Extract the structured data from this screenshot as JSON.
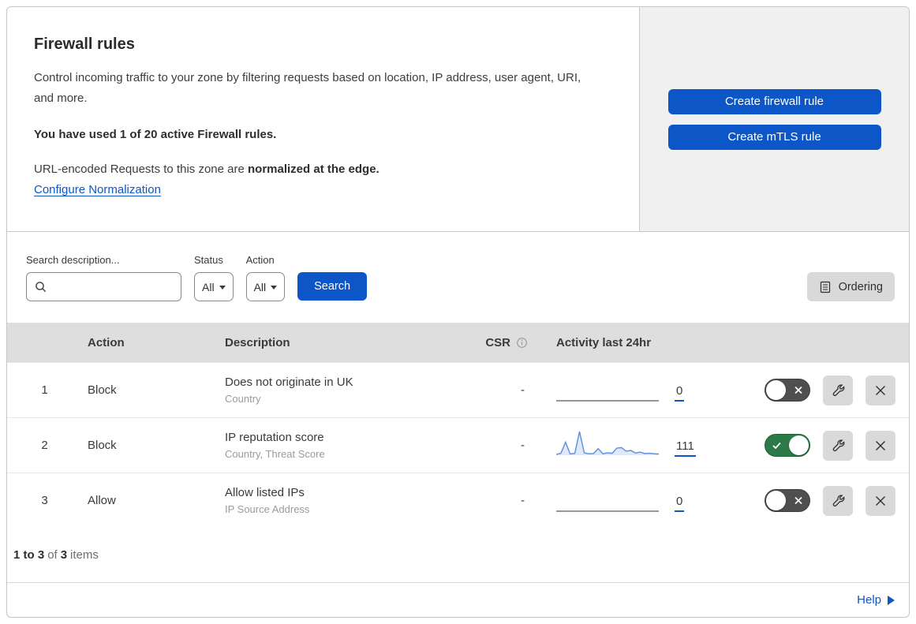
{
  "header": {
    "title": "Firewall rules",
    "description": "Control incoming traffic to your zone by filtering requests based on location, IP address, user agent, URI, and more.",
    "usage": "You have used 1 of 20 active Firewall rules.",
    "normalization_text": "URL-encoded Requests to this zone are",
    "normalization_bold": "normalized at the edge.",
    "normalization_link": "Configure Normalization",
    "buttons": {
      "create_firewall": "Create firewall rule",
      "create_mtls": "Create mTLS rule"
    }
  },
  "filters": {
    "search_label": "Search description...",
    "status_label": "Status",
    "status_value": "All",
    "action_label": "Action",
    "action_value": "All",
    "search_button": "Search",
    "ordering_button": "Ordering"
  },
  "table": {
    "columns": {
      "action": "Action",
      "description": "Description",
      "csr": "CSR",
      "activity": "Activity last 24hr"
    },
    "rows": [
      {
        "index": "1",
        "action": "Block",
        "description": "Does not originate in UK",
        "criteria": "Country",
        "csr": "-",
        "activity_count": "0",
        "enabled": false,
        "sparkline": null
      },
      {
        "index": "2",
        "action": "Block",
        "description": "IP reputation score",
        "criteria": "Country, Threat Score",
        "csr": "-",
        "activity_count": "111",
        "enabled": true,
        "sparkline": [
          3,
          8,
          55,
          5,
          8,
          100,
          10,
          6,
          7,
          28,
          6,
          10,
          8,
          30,
          32,
          17,
          20,
          9,
          13,
          7,
          8,
          6,
          5
        ]
      },
      {
        "index": "3",
        "action": "Allow",
        "description": "Allow listed IPs",
        "criteria": "IP Source Address",
        "csr": "-",
        "activity_count": "0",
        "enabled": false,
        "sparkline": null
      }
    ]
  },
  "footer": {
    "range": "1 to 3",
    "of": "of",
    "total": "3",
    "items": "items",
    "help": "Help"
  },
  "icons": {
    "search": "magnifier",
    "dropdown": "caret-down",
    "ordering": "list-document",
    "csr_info": "info-circle",
    "toggle_on": "check",
    "toggle_off": "x",
    "edit_rule": "wrench",
    "delete_rule": "x",
    "help": "right-triangle"
  },
  "colors": {
    "accent_blue": "#0d56c8",
    "panel_gray": "#f0f0f0",
    "table_header_gray": "#dedede",
    "toggle_on_green": "#2b7a47",
    "toggle_off_gray": "#4f4f4f",
    "sparkline_stroke": "#5b8ee0",
    "sparkline_fill": "#dfe9f8"
  }
}
